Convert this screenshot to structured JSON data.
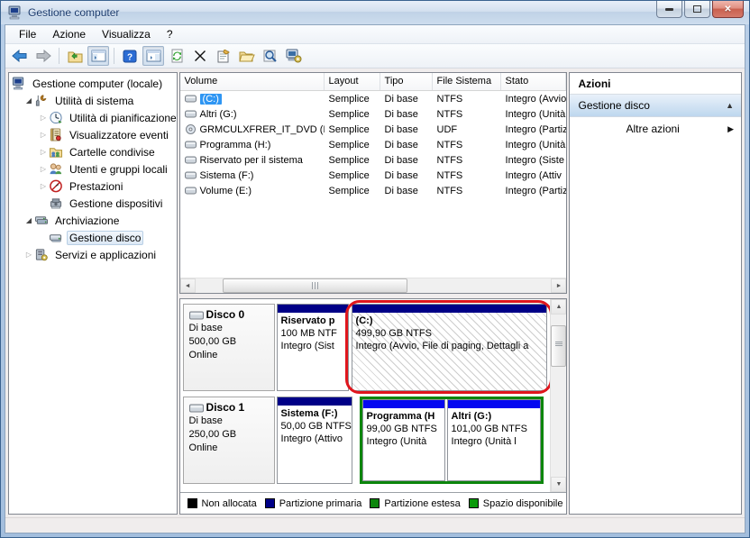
{
  "window": {
    "title": "Gestione computer"
  },
  "caption": {
    "minimize": "",
    "maximize": "",
    "close": "x"
  },
  "menu": {
    "items": [
      "File",
      "Azione",
      "Visualizza",
      "?"
    ]
  },
  "toolbar": {
    "icons": [
      "back",
      "forward",
      "export-list",
      "show-console-tree",
      "help",
      "show-action-pane",
      "refresh",
      "delete",
      "properties",
      "open",
      "find",
      "snap-in"
    ]
  },
  "tree": {
    "items": [
      {
        "label": "Gestione computer (locale)"
      },
      {
        "label": "Utilità di sistema"
      },
      {
        "label": "Utilità di pianificazione"
      },
      {
        "label": "Visualizzatore eventi"
      },
      {
        "label": "Cartelle condivise"
      },
      {
        "label": "Utenti e gruppi locali"
      },
      {
        "label": "Prestazioni"
      },
      {
        "label": "Gestione dispositivi"
      },
      {
        "label": "Archiviazione"
      },
      {
        "label": "Gestione disco"
      },
      {
        "label": "Servizi e applicazioni"
      }
    ]
  },
  "volumes": {
    "columns": [
      "Volume",
      "Layout",
      "Tipo",
      "File Sistema",
      "Stato"
    ],
    "rows": [
      {
        "name": "(C:)",
        "layout": "Semplice",
        "type": "Di base",
        "fs": "NTFS",
        "status": "Integro (Avvio",
        "selected": true
      },
      {
        "name": "Altri (G:)",
        "layout": "Semplice",
        "type": "Di base",
        "fs": "NTFS",
        "status": "Integro (Unità"
      },
      {
        "name": "GRMCULXFRER_IT_DVD (D:)",
        "layout": "Semplice",
        "type": "Di base",
        "fs": "UDF",
        "status": "Integro (Partiz"
      },
      {
        "name": "Programma (H:)",
        "layout": "Semplice",
        "type": "Di base",
        "fs": "NTFS",
        "status": "Integro (Unità"
      },
      {
        "name": "Riservato per il sistema",
        "layout": "Semplice",
        "type": "Di base",
        "fs": "NTFS",
        "status": "Integro (Siste"
      },
      {
        "name": "Sistema (F:)",
        "layout": "Semplice",
        "type": "Di base",
        "fs": "NTFS",
        "status": "Integro (Attiv"
      },
      {
        "name": "Volume (E:)",
        "layout": "Semplice",
        "type": "Di base",
        "fs": "NTFS",
        "status": "Integro (Partiz"
      }
    ]
  },
  "disks": [
    {
      "name": "Disco 0",
      "type": "Di base",
      "size": "500,00 GB",
      "status": "Online",
      "partitions": [
        {
          "name": "Riservato p",
          "size": "100 MB NTF",
          "status": "Integro (Sist"
        },
        {
          "name": "(C:)",
          "size": "499,90 GB NTFS",
          "status": "Integro (Avvio, File di paging, Dettagli a"
        }
      ]
    },
    {
      "name": "Disco 1",
      "type": "Di base",
      "size": "250,00 GB",
      "status": "Online",
      "partitions": [
        {
          "name": "Sistema  (F:)",
          "size": "50,00 GB NTFS",
          "status": "Integro (Attivo"
        },
        {
          "name": "Programma  (H",
          "size": "99,00 GB NTFS",
          "status": "Integro (Unità"
        },
        {
          "name": "Altri  (G:)",
          "size": "101,00 GB NTFS",
          "status": "Integro (Unità l"
        }
      ]
    }
  ],
  "legend": {
    "items": [
      {
        "label": "Non allocata",
        "color": "#000000"
      },
      {
        "label": "Partizione primaria",
        "color": "#000087"
      },
      {
        "label": "Partizione estesa",
        "color": "#0c860c"
      },
      {
        "label": "Spazio disponibile",
        "color": "#0a9a0a"
      }
    ]
  },
  "actions": {
    "title": "Azioni",
    "group_label": "Gestione disco",
    "item_label": "Altre azioni"
  },
  "colors": {
    "selection": "#2f96f3",
    "annotation": "#e0161d",
    "primary_partition_bar": "#000087",
    "logical_drive_bar": "#0408f0",
    "extended_partition_border": "#0c860c"
  }
}
